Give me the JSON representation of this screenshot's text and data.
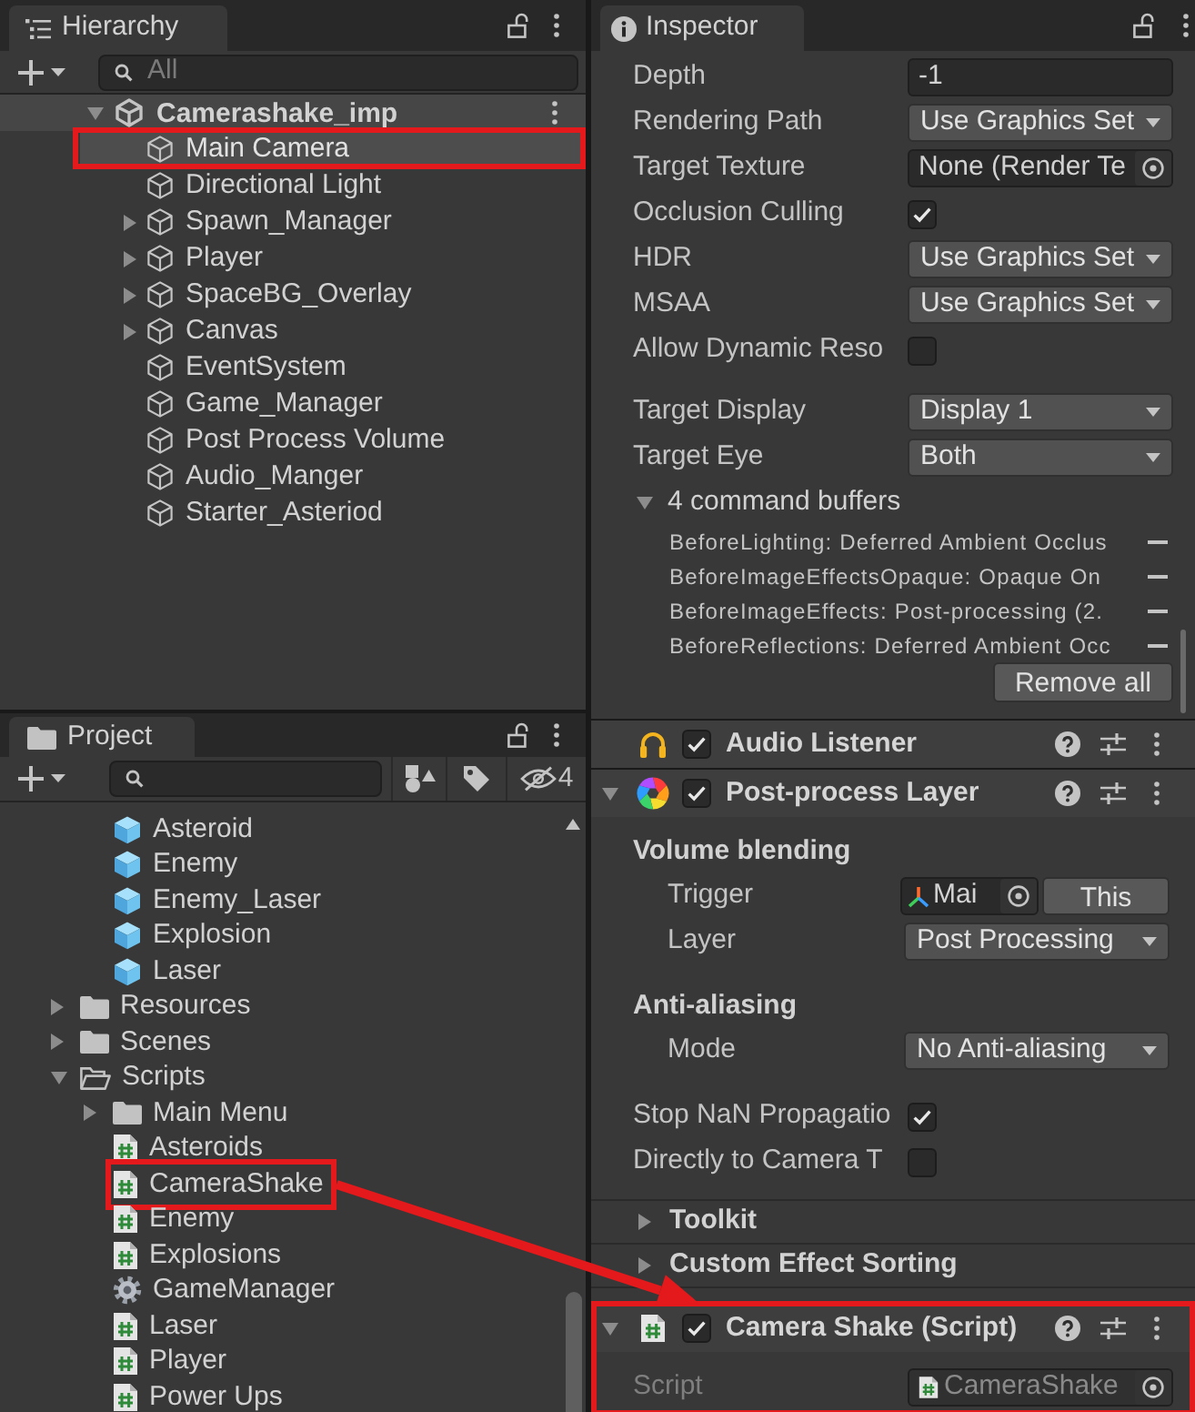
{
  "hierarchy": {
    "title": "Hierarchy",
    "search": {
      "placeholder": "All"
    },
    "scene": {
      "name": "Camerashake_imp",
      "expanded": true
    },
    "items": [
      {
        "name": "Main Camera",
        "has_children": false,
        "selected": true,
        "highlighted": true
      },
      {
        "name": "Directional Light",
        "has_children": false,
        "selected": false,
        "highlighted": false
      },
      {
        "name": "Spawn_Manager",
        "has_children": true,
        "selected": false,
        "highlighted": false
      },
      {
        "name": "Player",
        "has_children": true,
        "selected": false,
        "highlighted": false
      },
      {
        "name": "SpaceBG_Overlay",
        "has_children": true,
        "selected": false,
        "highlighted": false
      },
      {
        "name": "Canvas",
        "has_children": true,
        "selected": false,
        "highlighted": false
      },
      {
        "name": "EventSystem",
        "has_children": false,
        "selected": false,
        "highlighted": false
      },
      {
        "name": "Game_Manager",
        "has_children": false,
        "selected": false,
        "highlighted": false
      },
      {
        "name": "Post Process Volume",
        "has_children": false,
        "selected": false,
        "highlighted": false
      },
      {
        "name": "Audio_Manger",
        "has_children": false,
        "selected": false,
        "highlighted": false
      },
      {
        "name": "Starter_Asteriod",
        "has_children": false,
        "selected": false,
        "highlighted": false
      }
    ]
  },
  "project": {
    "title": "Project",
    "hidden_count": "4",
    "tree": [
      {
        "kind": "folder_contents",
        "children": [
          {
            "kind": "prefab",
            "name": "Asteroid",
            "selected": false,
            "highlighted": false
          },
          {
            "kind": "prefab",
            "name": "Enemy",
            "selected": false,
            "highlighted": false
          },
          {
            "kind": "prefab",
            "name": "Enemy_Laser",
            "selected": false,
            "highlighted": false
          },
          {
            "kind": "prefab",
            "name": "Explosion",
            "selected": false,
            "highlighted": false
          },
          {
            "kind": "prefab",
            "name": "Laser",
            "selected": false,
            "highlighted": false
          }
        ]
      },
      {
        "kind": "folder",
        "name": "Resources",
        "expanded": false,
        "selected": false,
        "highlighted": false
      },
      {
        "kind": "folder",
        "name": "Scenes",
        "expanded": false,
        "selected": false,
        "highlighted": false
      },
      {
        "kind": "folder",
        "name": "Scripts",
        "expanded": true,
        "selected": false,
        "highlighted": false,
        "children": [
          {
            "kind": "folder",
            "name": "Main Menu",
            "expanded": false,
            "selected": false,
            "highlighted": false
          },
          {
            "kind": "script",
            "name": "Asteroids",
            "selected": false,
            "highlighted": false
          },
          {
            "kind": "script",
            "name": "CameraShake",
            "selected": false,
            "highlighted": true
          },
          {
            "kind": "script",
            "name": "Enemy",
            "selected": false,
            "highlighted": false
          },
          {
            "kind": "script",
            "name": "Explosions",
            "selected": false,
            "highlighted": false
          },
          {
            "kind": "manager_script",
            "name": "GameManager",
            "selected": false,
            "highlighted": false
          },
          {
            "kind": "script",
            "name": "Laser",
            "selected": false,
            "highlighted": false
          },
          {
            "kind": "script",
            "name": "Player",
            "selected": false,
            "highlighted": false
          },
          {
            "kind": "script",
            "name": "Power Ups",
            "selected": false,
            "highlighted": false
          }
        ]
      }
    ]
  },
  "inspector": {
    "title": "Inspector",
    "camera_fields": [
      {
        "label": "Depth",
        "kind": "number",
        "value": "-1"
      },
      {
        "label": "Rendering Path",
        "kind": "dropdown",
        "value": "Use Graphics Set"
      },
      {
        "label": "Target Texture",
        "kind": "object",
        "value": "None (Render Te"
      },
      {
        "label": "Occlusion Culling",
        "kind": "checkbox",
        "checked": true
      },
      {
        "label": "HDR",
        "kind": "dropdown",
        "value": "Use Graphics Set"
      },
      {
        "label": "MSAA",
        "kind": "dropdown",
        "value": "Use Graphics Set"
      },
      {
        "label": "Allow Dynamic Reso",
        "kind": "checkbox",
        "checked": false
      }
    ],
    "display_fields": [
      {
        "label": "Target Display",
        "kind": "dropdown",
        "value": "Display 1"
      },
      {
        "label": "Target Eye",
        "kind": "dropdown",
        "value": "Both"
      }
    ],
    "command_buffers": {
      "label": "4 command buffers",
      "expanded": true,
      "items": [
        "BeforeLighting: Deferred Ambient Occlus",
        "BeforeImageEffectsOpaque: Opaque On",
        "BeforeImageEffects: Post-processing (2.",
        "BeforeReflections: Deferred Ambient Occ"
      ],
      "button": "Remove all"
    },
    "components": [
      {
        "kind": "audio_listener",
        "title": "Audio Listener",
        "enabled": true,
        "highlighted": false
      },
      {
        "kind": "postprocess_layer",
        "title": "Post-process Layer",
        "enabled": true,
        "expanded": true,
        "highlighted": false,
        "sections": [
          {
            "heading": "Volume blending",
            "fields": [
              {
                "label": "Trigger",
                "kind": "object_button",
                "value": "Mai",
                "button": "This"
              },
              {
                "label": "Layer",
                "kind": "dropdown",
                "value": "Post Processing"
              }
            ]
          },
          {
            "heading": "Anti-aliasing",
            "fields": [
              {
                "label": "Mode",
                "kind": "dropdown",
                "value": "No Anti-aliasing"
              }
            ]
          },
          {
            "fields": [
              {
                "label": "Stop NaN Propagatio",
                "kind": "checkbox",
                "checked": true
              },
              {
                "label": "Directly to Camera T",
                "kind": "checkbox",
                "checked": false
              }
            ]
          }
        ],
        "foldouts": [
          {
            "title": "Toolkit",
            "expanded": false
          },
          {
            "title": "Custom Effect Sorting",
            "expanded": false
          }
        ]
      },
      {
        "kind": "script",
        "title": "Camera Shake (Script)",
        "enabled": true,
        "expanded": true,
        "highlighted": true,
        "sections": [
          {
            "fields": [
              {
                "label": "Script",
                "kind": "script_object",
                "value": "CameraShake",
                "disabled": true
              }
            ]
          }
        ]
      }
    ]
  }
}
